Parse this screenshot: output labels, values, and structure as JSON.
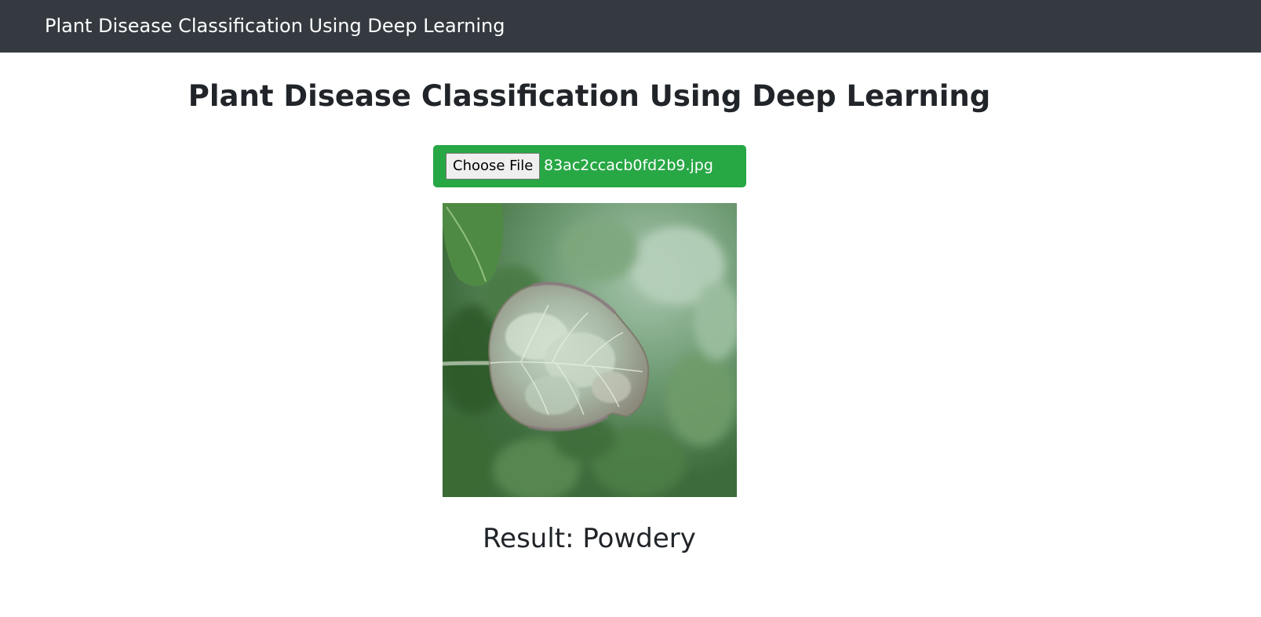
{
  "navbar": {
    "brand": "Plant Disease Classification Using Deep Learning"
  },
  "main": {
    "title": "Plant Disease Classification Using Deep Learning",
    "upload": {
      "button_label": "Choose File",
      "file_name": "83ac2ccacb0fd2b9.jpg",
      "background_color": "#28a745"
    },
    "result": {
      "text": "Result: Powdery"
    }
  },
  "colors": {
    "navbar_bg": "#343a40",
    "text": "#212529",
    "upload_bg": "#28a745"
  }
}
